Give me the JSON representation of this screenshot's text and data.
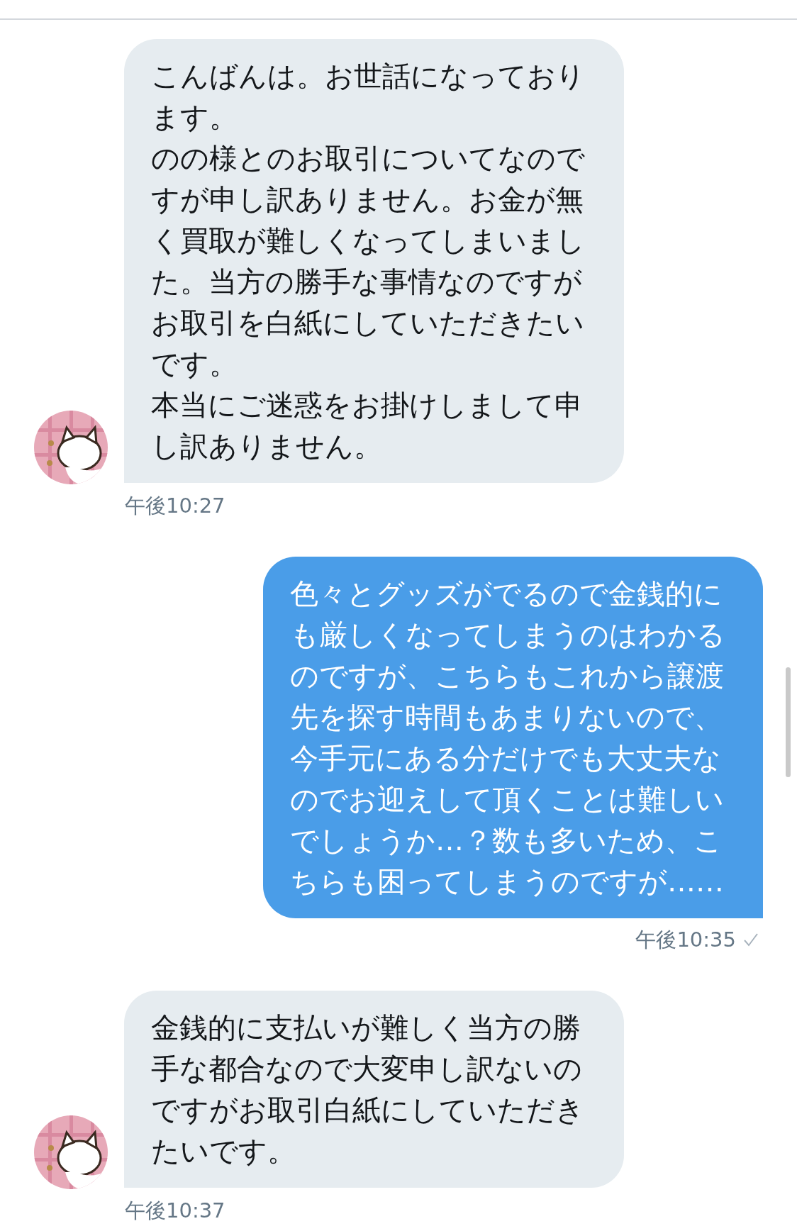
{
  "messages": [
    {
      "kind": "received",
      "paragraphs": [
        "こんばんは。お世話になっております。",
        "のの様とのお取引についてなのですが申し訳ありません。お金が無く買取が難しくなってしまいました。当方の勝手な事情なのですがお取引を白紙にしていただきたいです。",
        "本当にご迷惑をお掛けしまして申し訳ありません。"
      ],
      "time": "午後10:27"
    },
    {
      "kind": "sent",
      "paragraphs": [
        "色々とグッズがでるので金銭的にも厳しくなってしまうのはわかるのですが、こちらもこれから譲渡先を探す時間もあまりないので、今手元にある分だけでも大丈夫なのでお迎えして頂くことは難しいでしょうか…？数も多いため、こちらも困ってしまうのですが……"
      ],
      "time": "午後10:35",
      "read": true
    },
    {
      "kind": "received",
      "paragraphs": [
        "金銭的に支払いが難しく当方の勝手な都合なので大変申し訳ないのですがお取引白紙にしていただきたいです。"
      ],
      "time": "午後10:37"
    }
  ]
}
